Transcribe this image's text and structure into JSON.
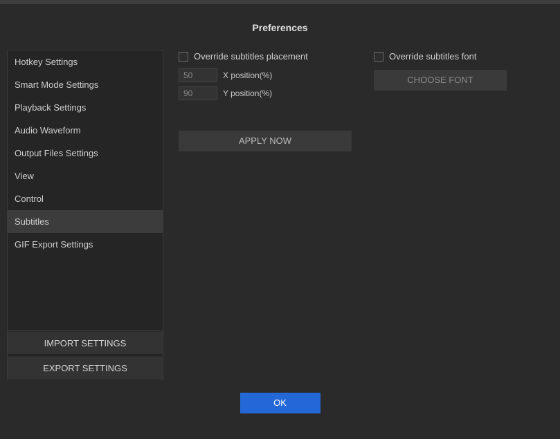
{
  "title": "Preferences",
  "sidebar": {
    "items": [
      {
        "label": "Hotkey Settings"
      },
      {
        "label": "Smart Mode Settings"
      },
      {
        "label": "Playback Settings"
      },
      {
        "label": "Audio Waveform"
      },
      {
        "label": "Output Files Settings"
      },
      {
        "label": "View"
      },
      {
        "label": "Control"
      },
      {
        "label": "Subtitles"
      },
      {
        "label": "GIF Export Settings"
      }
    ],
    "selectedIndex": 7,
    "importLabel": "IMPORT SETTINGS",
    "exportLabel": "EXPORT SETTINGS"
  },
  "subtitles": {
    "overridePlacementLabel": "Override subtitles placement",
    "overrideFontLabel": "Override subtitles font",
    "xpos": {
      "value": "50",
      "label": "X position(%)"
    },
    "ypos": {
      "value": "90",
      "label": "Y position(%)"
    },
    "applyLabel": "APPLY NOW",
    "chooseFontLabel": "CHOOSE FONT"
  },
  "footer": {
    "okLabel": "OK"
  }
}
